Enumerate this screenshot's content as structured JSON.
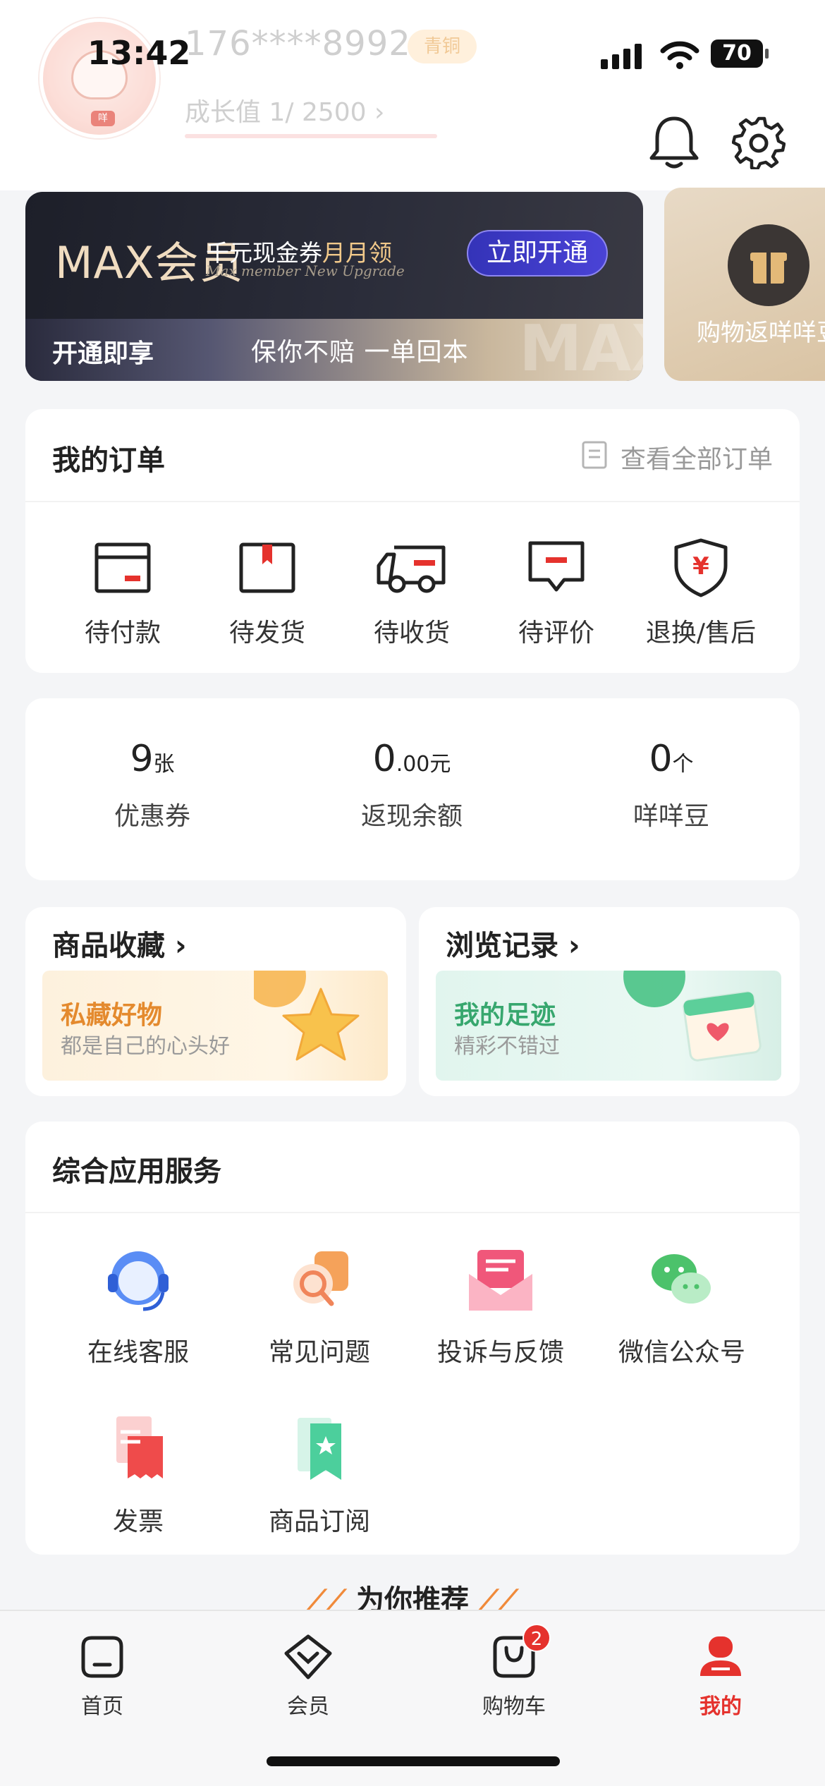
{
  "status_bar": {
    "time": "13:42",
    "battery": "70"
  },
  "profile": {
    "phone": "176****8992",
    "level": "青铜",
    "growth_label": "成长值",
    "growth_value": "1",
    "growth_total": "/ 2500",
    "growth_progress": 0.0004
  },
  "banner": {
    "max_title": "MAX会员",
    "promo_prefix": "千元现金券",
    "promo_highlight": "月月领",
    "promo_subtitle": "Max member  New Upgrade",
    "button": "立即开通",
    "enjoy": "开通即享",
    "guarantee": "保你不赔 一单回本",
    "watermark": "MAX"
  },
  "side_card": {
    "label": "购物返咩咩豆"
  },
  "orders": {
    "title": "我的订单",
    "view_all": "查看全部订单",
    "items": [
      {
        "label": "待付款",
        "icon": "wallet-card-icon"
      },
      {
        "label": "待发货",
        "icon": "package-box-icon"
      },
      {
        "label": "待收货",
        "icon": "delivery-truck-icon"
      },
      {
        "label": "待评价",
        "icon": "comment-bubble-icon"
      },
      {
        "label": "退换/售后",
        "icon": "yuan-shield-icon"
      }
    ]
  },
  "wallet": {
    "items": [
      {
        "number": "9",
        "decimal": "",
        "unit": "张",
        "label": "优惠券"
      },
      {
        "number": "0",
        "decimal": ".00",
        "unit": "元",
        "label": "返现余额"
      },
      {
        "number": "0",
        "decimal": "",
        "unit": "个",
        "label": "咩咩豆"
      }
    ]
  },
  "favorites": {
    "title": "商品收藏",
    "headline": "私藏好物",
    "subline": "都是自己的心头好"
  },
  "history": {
    "title": "浏览记录",
    "headline": "我的足迹",
    "subline": "精彩不错过"
  },
  "services": {
    "title": "综合应用服务",
    "items": [
      {
        "label": "在线客服",
        "icon": "headset-icon"
      },
      {
        "label": "常见问题",
        "icon": "question-icon"
      },
      {
        "label": "投诉与反馈",
        "icon": "mail-feedback-icon"
      },
      {
        "label": "微信公众号",
        "icon": "wechat-icon"
      },
      {
        "label": "发票",
        "icon": "invoice-icon"
      },
      {
        "label": "商品订阅",
        "icon": "subscribe-bookmark-icon"
      }
    ]
  },
  "recommend": {
    "title": "为你推荐"
  },
  "tabbar": {
    "items": [
      {
        "label": "首页",
        "icon": "home-icon"
      },
      {
        "label": "会员",
        "icon": "member-icon"
      },
      {
        "label": "购物车",
        "icon": "cart-icon",
        "badge": "2"
      },
      {
        "label": "我的",
        "icon": "profile-icon"
      }
    ]
  },
  "colors": {
    "accent": "#e5322d",
    "vip_button": "#3a38c8",
    "gold": "#f2c98a"
  }
}
